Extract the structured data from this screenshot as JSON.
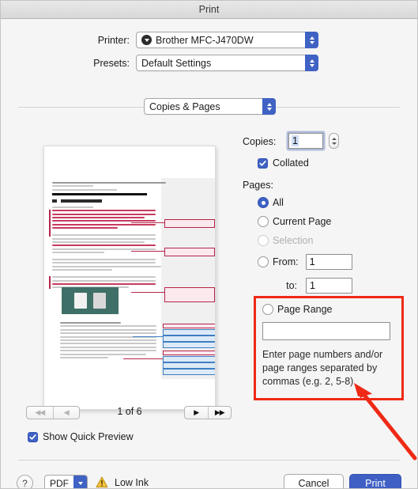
{
  "window": {
    "title": "Print"
  },
  "printer": {
    "label": "Printer:",
    "value": "Brother MFC-J470DW",
    "icon": "printer-status-icon"
  },
  "presets": {
    "label": "Presets:",
    "value": "Default Settings"
  },
  "pane_popup": {
    "value": "Copies & Pages"
  },
  "copies": {
    "label": "Copies:",
    "value": "1",
    "collated_label": "Collated",
    "collated_checked": true
  },
  "pages": {
    "label": "Pages:",
    "options": [
      {
        "label": "All",
        "selected": true,
        "disabled": false
      },
      {
        "label": "Current Page",
        "selected": false,
        "disabled": false
      },
      {
        "label": "Selection",
        "selected": false,
        "disabled": true
      }
    ],
    "from_label": "From:",
    "from_value": "1",
    "to_label": "to:",
    "to_value": "1"
  },
  "page_range": {
    "label": "Page Range",
    "selected": false,
    "input_value": "",
    "hint": "Enter page numbers and/or page ranges separated by commas (e.g. 2, 5-8)",
    "highlight_color": "#ee2a16"
  },
  "preview": {
    "page_count_text": "1 of 6",
    "first_page_button": "◀◀",
    "prev_page_button": "◀",
    "next_page_button": "▶",
    "last_page_button": "▶▶",
    "first_disabled": true,
    "prev_disabled": true,
    "quick_preview_label": "Show Quick Preview",
    "quick_preview_checked": true
  },
  "footer": {
    "help_label": "?",
    "pdf_label": "PDF",
    "low_ink_label": "Low Ink",
    "cancel_label": "Cancel",
    "print_label": "Print"
  },
  "colors": {
    "accent_blue": "#3f62c4",
    "print_button": "#3f5fc4",
    "annotation_red": "#ee2a16",
    "warning_yellow": "#f5c13a"
  }
}
